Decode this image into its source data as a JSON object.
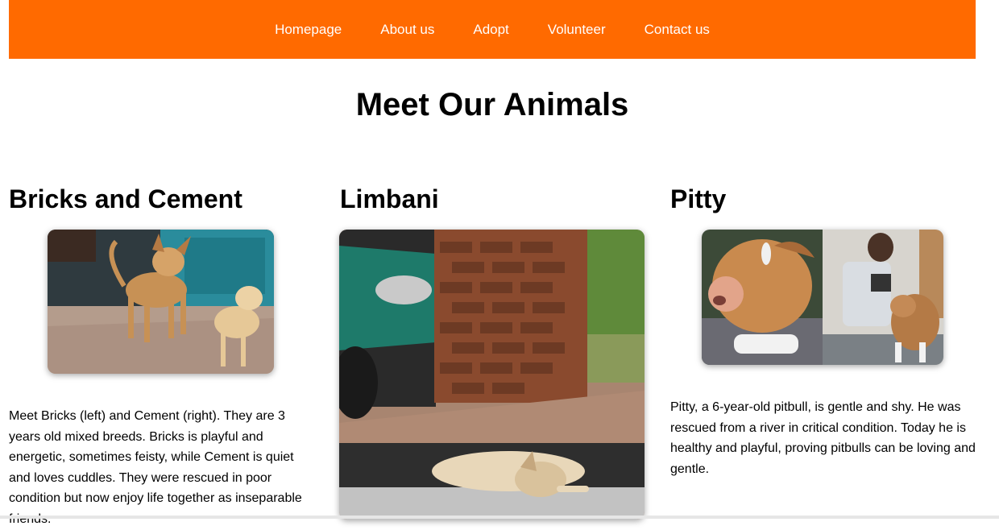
{
  "nav": {
    "items": [
      "Homepage",
      "About us",
      "Adopt",
      "Volunteer",
      "Contact us"
    ]
  },
  "page": {
    "title": "Meet Our Animals"
  },
  "animals": [
    {
      "name": "Bricks and Cement",
      "description": "Meet Bricks (left) and Cement (right). They are 3 years old mixed breeds. Bricks is playful and energetic, sometimes feisty, while Cement is quiet and loves cuddles. They were rescued in poor condition but now enjoy life together as inseparable friends."
    },
    {
      "name": "Limbani",
      "description": ""
    },
    {
      "name": "Pitty",
      "description": "Pitty, a 6-year-old pitbull, is gentle and shy. He was rescued from a river in critical condition. Today he is healthy and playful, proving pitbulls can be loving and gentle."
    }
  ],
  "colors": {
    "nav_background": "#ff6a00",
    "nav_text": "#ffffff"
  }
}
